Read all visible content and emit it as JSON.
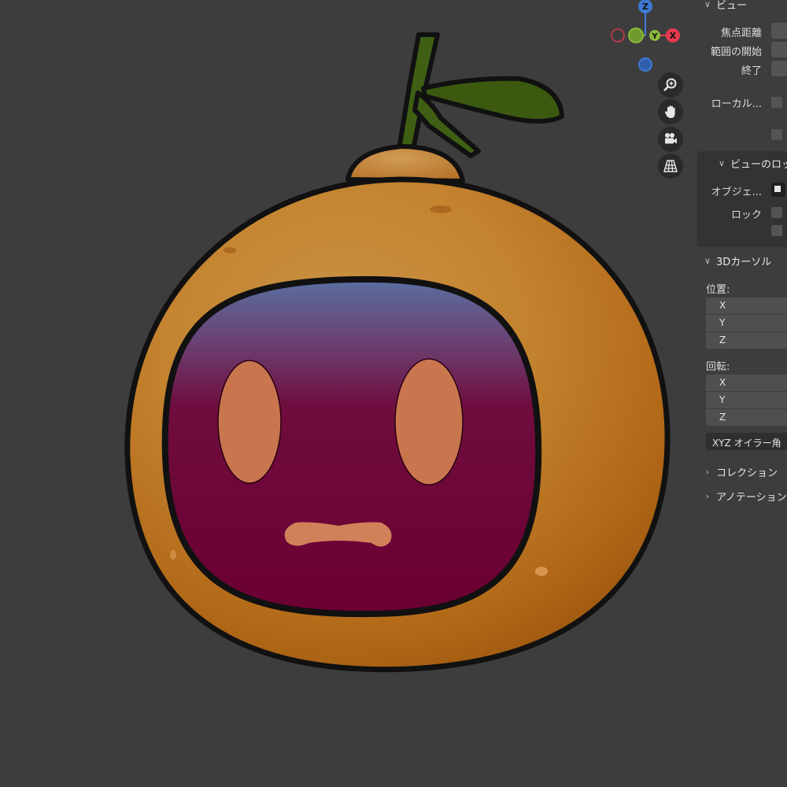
{
  "viewport": {
    "gizmo": {
      "axes": [
        "Z",
        "Y",
        "X"
      ],
      "colors": {
        "x": "#e5394f",
        "y": "#8ab93a",
        "z": "#3d7ad6"
      }
    },
    "nav_icons": [
      "zoom-icon",
      "hand-pan-icon",
      "camera-icon",
      "perspective-grid-icon"
    ],
    "colors": {
      "background": "#3d3d3d"
    }
  },
  "sidebar": {
    "view_panel": {
      "title": "ビュー",
      "focal_length_label": "焦点距離",
      "clip_start_label": "範囲の開始",
      "clip_end_label": "終了",
      "local_camera_label": "ローカル..."
    },
    "view_lock_panel": {
      "title": "ビューのロッ",
      "object_label": "オブジェ...",
      "lock_label": "ロック"
    },
    "cursor_panel": {
      "title": "3Dカーソル",
      "location_label": "位置:",
      "location_axes": [
        "X",
        "Y",
        "Z"
      ],
      "rotation_label": "回転:",
      "rotation_axes": [
        "X",
        "Y",
        "Z"
      ],
      "rotation_mode": "XYZ オイラー角"
    },
    "collection_panel": {
      "title": "コレクション"
    },
    "annotation_panel": {
      "title": "アノテーション"
    }
  }
}
